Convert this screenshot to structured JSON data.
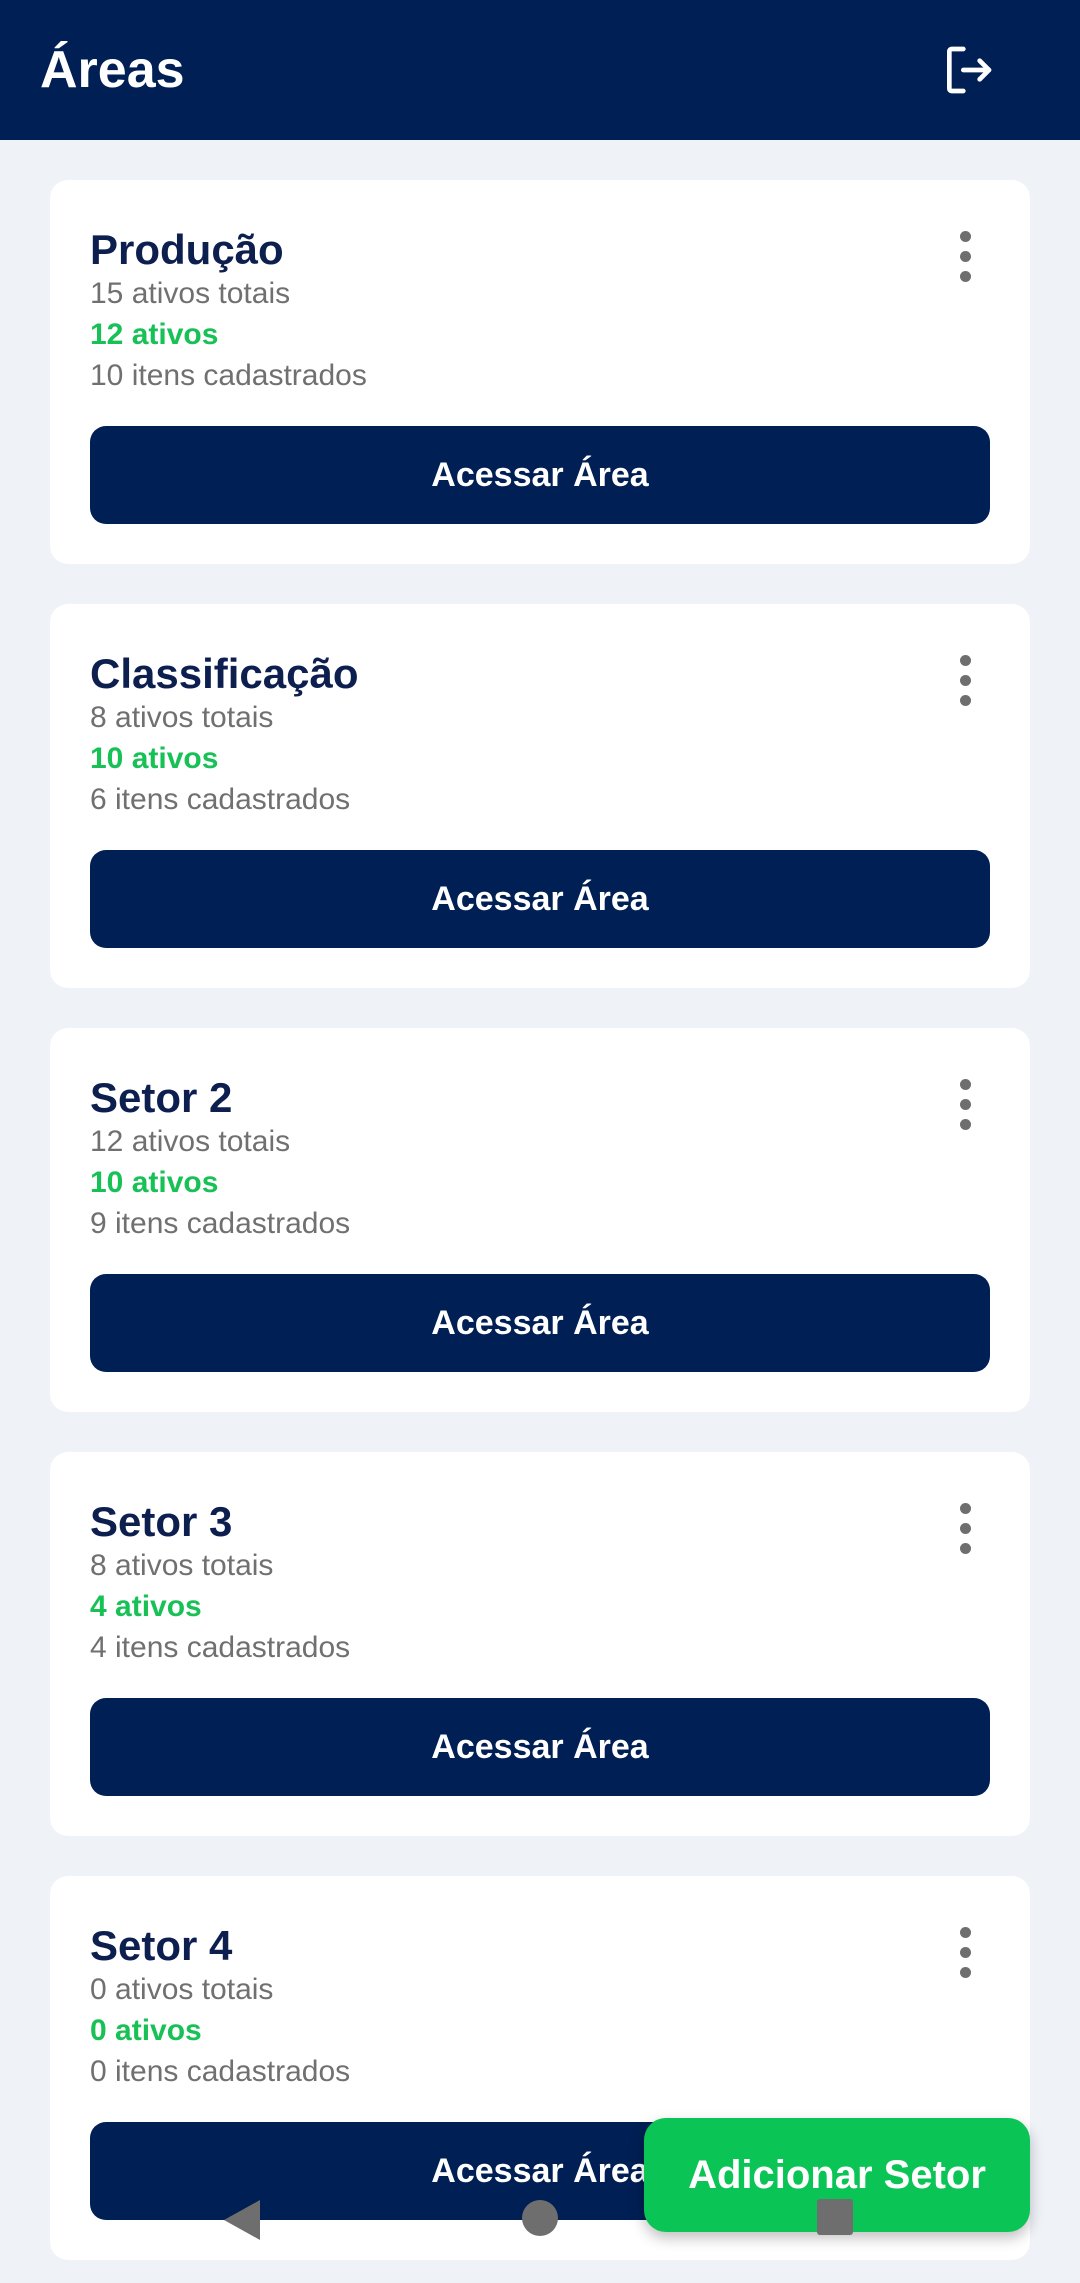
{
  "appbar": {
    "title": "Áreas",
    "logout_icon": "logout-icon"
  },
  "cards": [
    {
      "name": "Produção",
      "total": "15 ativos totais",
      "active": "12 ativos",
      "items": "10 itens cadastrados",
      "button": "Acessar Área"
    },
    {
      "name": "Classificação",
      "total": "8 ativos totais",
      "active": "10 ativos",
      "items": "6 itens cadastrados",
      "button": "Acessar Área"
    },
    {
      "name": "Setor 2",
      "total": "12 ativos totais",
      "active": "10 ativos",
      "items": "9 itens cadastrados",
      "button": "Acessar Área"
    },
    {
      "name": "Setor 3",
      "total": "8 ativos totais",
      "active": "4 ativos",
      "items": "4 itens cadastrados",
      "button": "Acessar Área"
    },
    {
      "name": "Setor 4",
      "total": "0 ativos totais",
      "active": "0 ativos",
      "items": "0 itens cadastrados",
      "button": "Acessar Área"
    }
  ],
  "fab": {
    "label": "Adicionar Setor"
  },
  "colors": {
    "primary": "#001f54",
    "accent_green": "#18c155",
    "background": "#eff2f7"
  },
  "navigation": {
    "back_icon": "back-triangle-icon",
    "home_icon": "home-circle-icon",
    "recents_icon": "recents-square-icon"
  }
}
